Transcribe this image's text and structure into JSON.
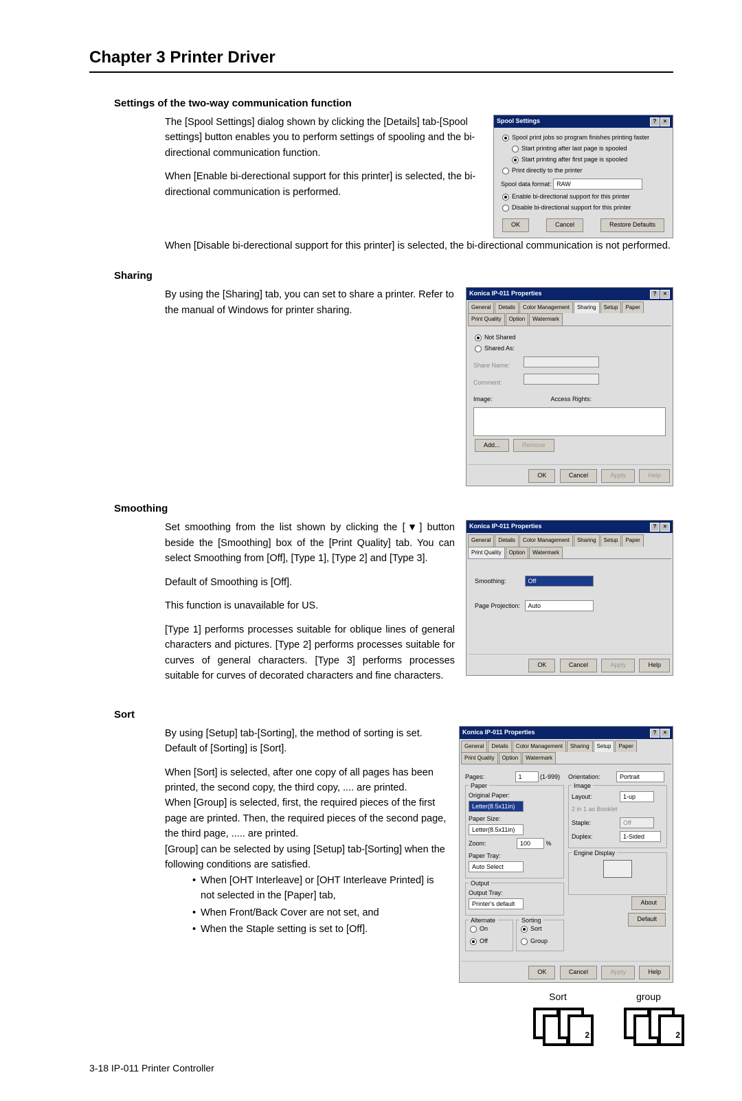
{
  "chapter_title": "Chapter 3   Printer Driver",
  "sec1": {
    "heading": "Settings of the two-way communication function",
    "p1": "The [Spool Settings] dialog shown by clicking the [Details] tab-[Spool settings] button enables you to perform settings of spooling and the bi-directional communication function.",
    "p2": "When [Enable bi-derectional support for this printer] is selected, the bi-directional  communication is performed.",
    "p3": "When [Disable bi-derectional support for this printer] is selected, the bi-directional communication is not performed."
  },
  "spool_dialog": {
    "title": "Spool Settings",
    "r1": "Spool print jobs so program finishes printing faster",
    "r1a": "Start printing after last page is spooled",
    "r1b": "Start printing after first page is spooled",
    "r2": "Print directly to the printer",
    "fmt_label": "Spool data format:",
    "fmt_value": "RAW",
    "r3": "Enable bi-directional support for this printer",
    "r4": "Disable bi-directional support for this printer",
    "ok": "OK",
    "cancel": "Cancel",
    "restore": "Restore Defaults"
  },
  "sec2": {
    "heading": "Sharing",
    "p1": "By using the [Sharing] tab, you can set to share a printer. Refer to the manual of Windows for printer sharing."
  },
  "sharing_dialog": {
    "title": "Konica IP-011 Properties",
    "tabs": [
      "General",
      "Details",
      "Color Management",
      "Sharing",
      "Setup",
      "Paper",
      "Print Quality",
      "Option",
      "Watermark"
    ],
    "not_shared": "Not Shared",
    "shared_as": "Shared As:",
    "share_name": "Share Name:",
    "comment": "Comment:",
    "image_label": "Image:",
    "access_label": "Access Rights:",
    "add": "Add...",
    "remove": "Remove",
    "ok": "OK",
    "cancel": "Cancel",
    "apply": "Apply",
    "help": "Help"
  },
  "sec3": {
    "heading": "Smoothing",
    "p1": "Set smoothing from the list shown by clicking the [▼] button beside the [Smoothing] box of the [Print Quality] tab. You can select Smoothing from [Off], [Type 1], [Type 2] and [Type 3].",
    "p2": "Default of Smoothing is [Off].",
    "p3": "This function is unavailable for US.",
    "p4": "[Type 1] performs processes suitable for oblique lines of general characters and pictures. [Type 2] performs processes suitable for curves of general characters. [Type 3] performs processes suitable for curves of decorated characters and fine characters."
  },
  "smoothing_dialog": {
    "title": "Konica IP-011 Properties",
    "smoothing_label": "Smoothing:",
    "smoothing_value": "Off",
    "pp_label": "Page Projection:",
    "pp_value": "Auto",
    "ok": "OK",
    "cancel": "Cancel",
    "apply": "Apply",
    "help": "Help"
  },
  "sec4": {
    "heading": "Sort",
    "p1": "By using [Setup] tab-[Sorting], the method of sorting is set. Default of [Sorting] is [Sort].",
    "p2": "When [Sort] is selected, after one copy of all pages has been printed, the second copy, the third copy, .... are printed.",
    "p3": "When [Group] is selected, first, the required pieces of the first page are printed. Then, the required pieces of the second page, the third page, ..... are printed.",
    "p4": "[Group] can be selected by using [Setup] tab-[Sorting] when the following conditions are satisfied.",
    "b1": "When [OHT Interleave] or [OHT Interleave Printed] is not selected in the [Paper] tab,",
    "b2": "When Front/Back Cover are not set, and",
    "b3": "When the Staple setting is set to [Off]."
  },
  "setup_dialog": {
    "title": "Konica IP-011 Properties",
    "tabs": [
      "General",
      "Details",
      "Color Management",
      "Sharing",
      "Setup",
      "Paper",
      "Print Quality",
      "Option",
      "Watermark"
    ],
    "pages_label": "Pages:",
    "pages_value": "1",
    "pages_range": "(1-999)",
    "paper_group": "Paper",
    "original_label": "Original Paper:",
    "original_value": "Letter(8.5x11in)",
    "paper_size_label": "Paper Size:",
    "paper_size_value": "Letter(8.5x11in)",
    "zoom_label": "Zoom:",
    "zoom_value": "100",
    "zoom_pct": "%",
    "paper_tray_label": "Paper Tray:",
    "paper_tray_value": "Auto Select",
    "output_group": "Output",
    "output_tray_label": "Output Tray:",
    "output_tray_value": "Printer's default",
    "alternate_group": "Alternate",
    "alt_on": "On",
    "alt_off": "Off",
    "sorting_group": "Sorting",
    "sort_opt": "Sort",
    "group_opt": "Group",
    "orientation_label": "Orientation:",
    "orientation_value": "Portrait",
    "image_group": "Image",
    "layout_label": "Layout:",
    "layout_value": "1-up",
    "twoin1_label": "2 in 1 as Booklet",
    "staple_label": "Staple:",
    "staple_value": "Off",
    "duplex_label": "Duplex:",
    "duplex_value": "1-Sided",
    "engine_label": "Engine Display",
    "about": "About",
    "default": "Default",
    "ok": "OK",
    "cancel": "Cancel",
    "apply": "Apply",
    "help": "Help"
  },
  "sort_label": "Sort",
  "group_label": "group",
  "footer": "3-18  IP-011 Printer Controller"
}
